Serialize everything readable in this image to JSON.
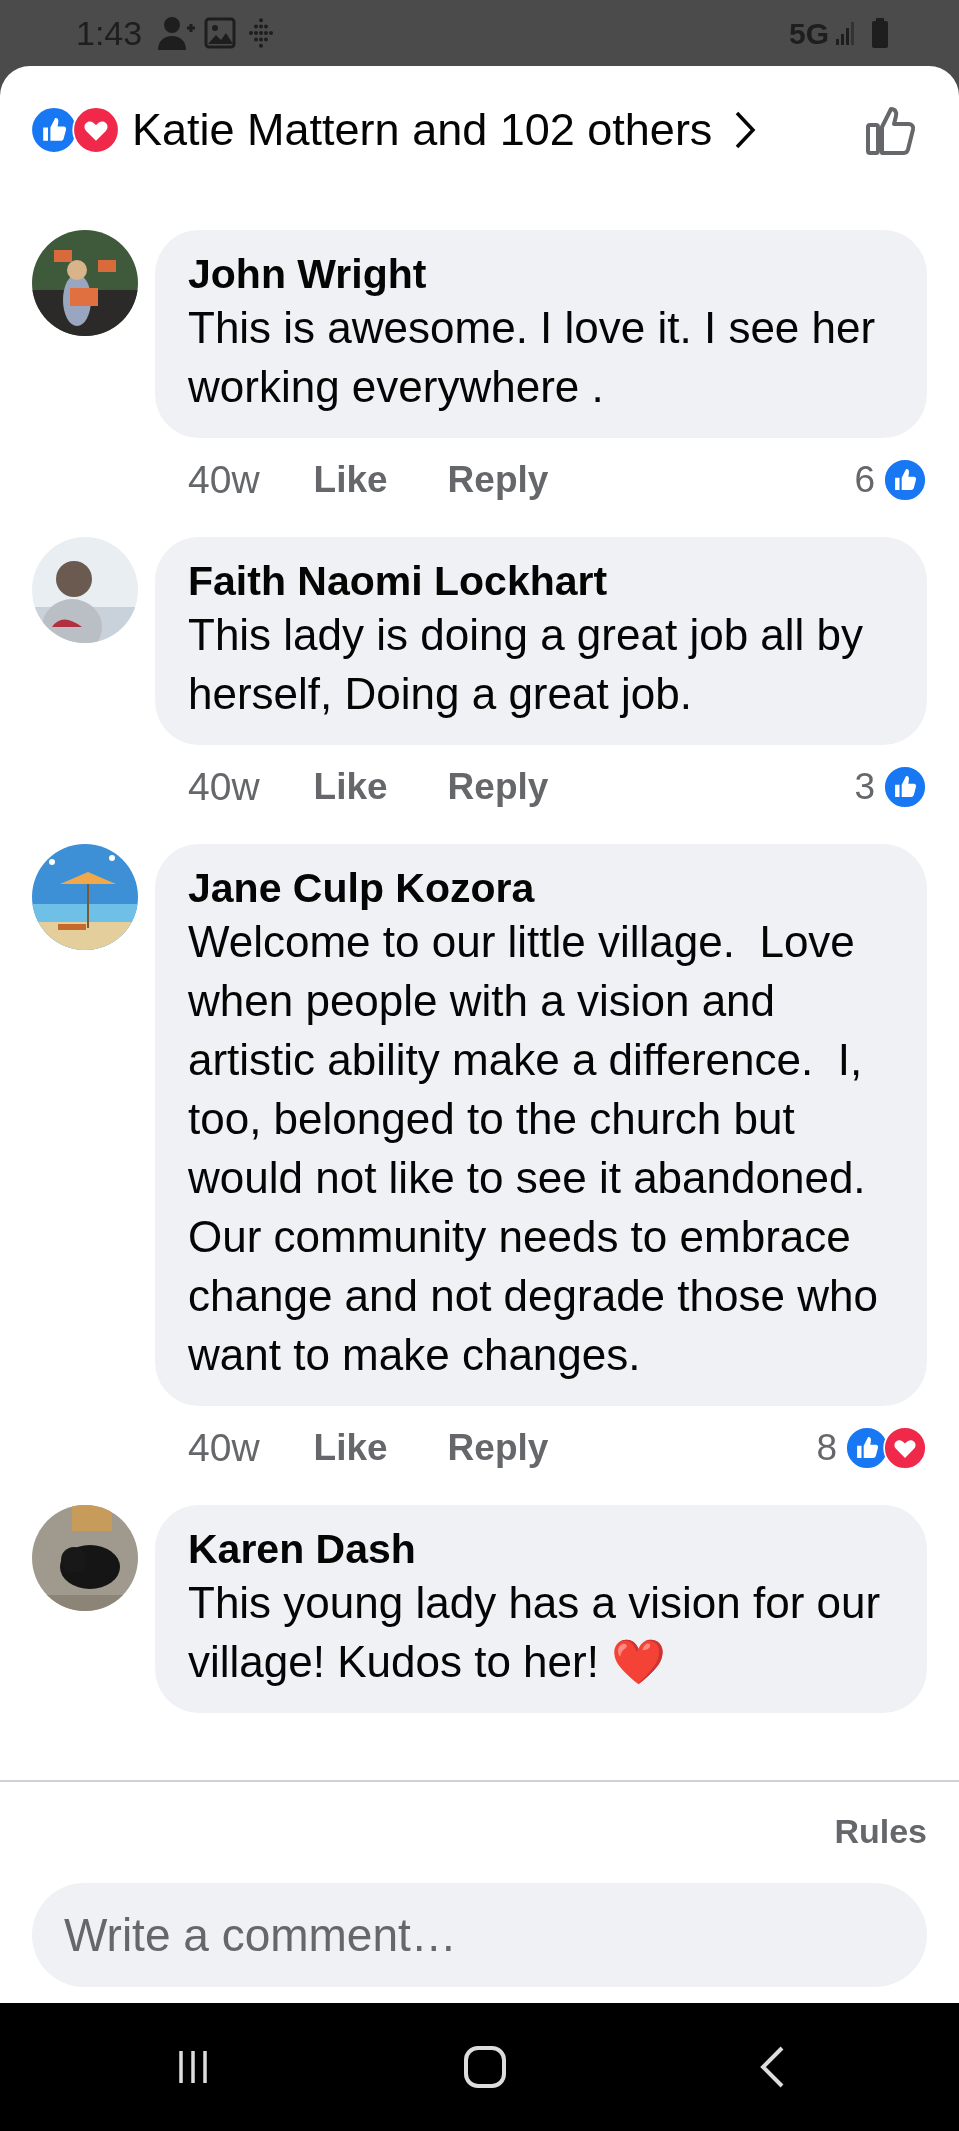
{
  "status_bar": {
    "time": "1:43",
    "network": "5G"
  },
  "reactions": {
    "summary": "Katie Mattern and 102 others",
    "types": [
      {
        "kind": "like"
      },
      {
        "kind": "love"
      }
    ],
    "liked": false
  },
  "comments": [
    {
      "author": "John Wright",
      "text": "This is awesome. I love it. I see her working everywhere .",
      "age": "40w",
      "actions": [
        "Like",
        "Reply"
      ],
      "reaction_count": "6",
      "reactions": [
        {
          "kind": "like"
        }
      ]
    },
    {
      "author": "Faith Naomi Lockhart",
      "text": "This lady is doing a great job all by herself, Doing a great job.",
      "age": "40w",
      "actions": [
        "Like",
        "Reply"
      ],
      "reaction_count": "3",
      "reactions": [
        {
          "kind": "like"
        }
      ]
    },
    {
      "author": "Jane Culp Kozora",
      "text": "Welcome to our little village.  Love when people with a vision and artistic ability make a difference.  I, too, belonged to the church but would not like to see it abandoned.  Our community needs to embrace change and not degrade those who want to make changes.",
      "age": "40w",
      "actions": [
        "Like",
        "Reply"
      ],
      "reaction_count": "8",
      "reactions": [
        {
          "kind": "like"
        },
        {
          "kind": "love"
        }
      ]
    },
    {
      "author": "Karen Dash",
      "text": "This young lady has a vision for our village! Kudos to her!",
      "emoji": "❤️"
    }
  ],
  "footer": {
    "rules": "Rules",
    "comment_placeholder": "Write a comment…"
  }
}
